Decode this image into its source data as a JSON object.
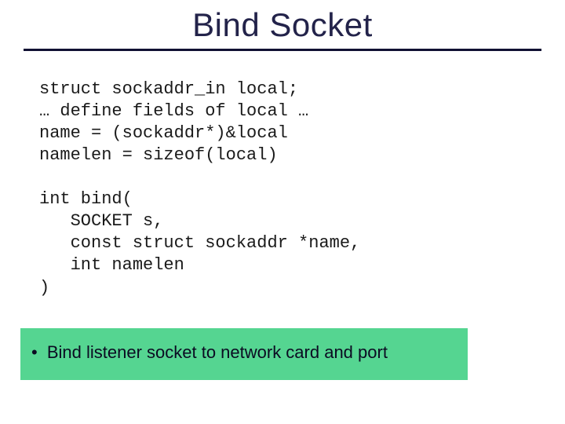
{
  "slide": {
    "title": "Bind Socket",
    "code_block_1": "struct sockaddr_in local;\n… define fields of local …\nname = (sockaddr*)&local\nnamelen = sizeof(local)",
    "code_block_2": "int bind(\n   SOCKET s,\n   const struct sockaddr *name,\n   int namelen\n)",
    "note_bullet": "•",
    "note_text": "Bind listener socket to network card and port"
  },
  "colors": {
    "accent_green": "#55d591",
    "rule": "#111133",
    "title": "#23234a"
  }
}
